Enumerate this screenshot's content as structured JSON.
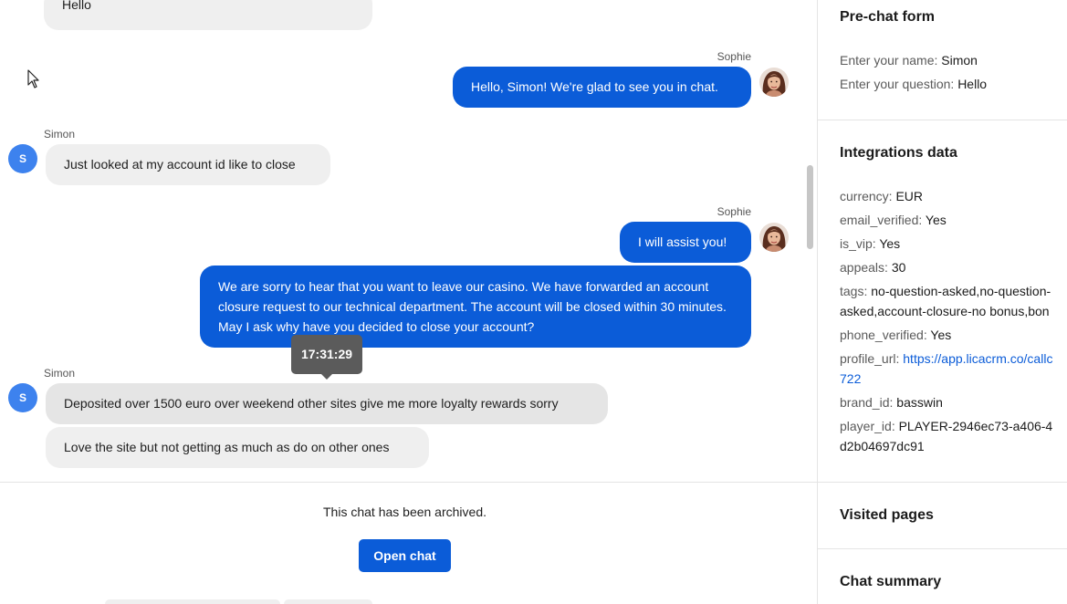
{
  "chat": {
    "messages": [
      {
        "sender": "",
        "text": "Hello"
      },
      {
        "sender": "Sophie",
        "text": "Hello, Simon! We're glad to see you in chat."
      },
      {
        "sender": "Simon",
        "text": "Just looked at my account id like to close"
      },
      {
        "sender": "Sophie",
        "text": "I will assist you!"
      },
      {
        "sender": "",
        "text": "We are sorry to hear that you want to leave our casino. We have forwarded an account closure request to our technical department. The account will be closed within 30 minutes. May I ask why have you decided to close your account?"
      },
      {
        "sender": "Simon",
        "text": "Deposited over 1500 euro over weekend other sites give me more loyalty rewards sorry"
      },
      {
        "sender": "",
        "text": "Love the site but not getting as much as do on other ones"
      }
    ],
    "avatar_initial": "S",
    "tooltip_time": "17:31:29",
    "archived_text": "This chat has been archived.",
    "open_chat_label": "Open chat"
  },
  "panel": {
    "prechat": {
      "title": "Pre-chat form",
      "fields": [
        {
          "key": "Enter your name:",
          "value": "Simon"
        },
        {
          "key": "Enter your question:",
          "value": "Hello"
        }
      ]
    },
    "integrations": {
      "title": "Integrations data",
      "currency": {
        "key": "currency:",
        "value": "EUR"
      },
      "email_verified": {
        "key": "email_verified:",
        "value": "Yes"
      },
      "is_vip": {
        "key": "is_vip:",
        "value": "Yes"
      },
      "appeals": {
        "key": "appeals:",
        "value": "30"
      },
      "tags": {
        "key": "tags:",
        "value_line1": "no-question-asked,no-question-",
        "value_line2": "asked,account-closure-no bonus,bon"
      },
      "phone_verified": {
        "key": "phone_verified:",
        "value": "Yes"
      },
      "profile_url": {
        "key": "profile_url:",
        "value_line1": "https://app.licacrm.co/callc",
        "value_line2": "722"
      },
      "brand_id": {
        "key": "brand_id:",
        "value": "basswin"
      },
      "player_id": {
        "key": "player_id:",
        "value_line1": "PLAYER-2946ec73-a406-4",
        "value_line2": "d2b04697dc91"
      }
    },
    "visited_pages_title": "Visited pages",
    "chat_summary_title": "Chat summary"
  },
  "colors": {
    "agent_bubble": "#0b5cd8",
    "visitor_bubble": "#efefef",
    "avatar_blue": "#3d82ee",
    "link": "#0b5cd8"
  },
  "icons": [
    "mouse-pointer-icon",
    "agent-avatar-photo"
  ]
}
